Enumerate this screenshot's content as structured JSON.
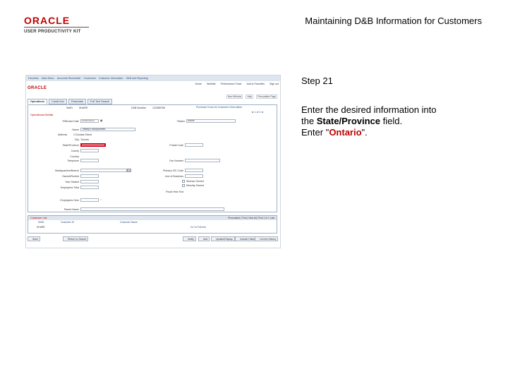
{
  "logo": {
    "word": "ORACLE",
    "sub": "USER PRODUCTIVITY KIT"
  },
  "page_title": "Maintaining D&B Information for Customers",
  "step_label": "Step 21",
  "instruction": {
    "line1": "Enter the desired information into",
    "line2_prefix": "the ",
    "field_name": "State/Province",
    "line2_suffix": " field.",
    "line3_prefix": "Enter \"",
    "value": "Ontario",
    "line3_suffix": "\"."
  },
  "screenshot": {
    "breadcrumbs": [
      "Favorites",
      "Main Menu",
      "Accounts Receivable",
      "Customers",
      "Customer Information",
      "D&B and Reporting"
    ],
    "oracle": "ORACLE",
    "nav_links": [
      "Home",
      "Worklist",
      "Performance Trace",
      "Add to Favorites",
      "Sign out"
    ],
    "page_links": [
      "New Window",
      "Help",
      "Personalize Page"
    ],
    "tabs": [
      {
        "label": "Operations",
        "active": true
      },
      {
        "label": "Credit Info",
        "active": false
      },
      {
        "label": "Financials",
        "active": false
      },
      {
        "label": "Full Text Search",
        "active": false
      }
    ],
    "header": {
      "setid_label": "SetID",
      "setid_value": "SHARE",
      "dnb_label": "D&B Number",
      "dnb_value": "123456789",
      "purchase_label": "Purchase Duns for Customer Information"
    },
    "panel_title": "Operational Details",
    "effective_date_label": "*Effective Date",
    "effective_date_value": "01/01/2013",
    "status_label": "*Status",
    "status_value": "Active",
    "name_label": "Name",
    "name_value": "Tiffany's Incorporated",
    "address_label": "Address",
    "address_value": "1 Dundas Street",
    "city_label": "City",
    "city_value": "Toronto",
    "state_label": "State/Province",
    "state_value": "",
    "postal_label": "Postal Code",
    "county_label": "County",
    "country_label": "Country",
    "telephone_label": "Telephone",
    "fax_label": "Fax Number",
    "headquarters_label": "Headquarters/Branch",
    "primary_sic_label": "Primary SIC Code",
    "owned_label": "Owned/Rented",
    "line_business_label": "Line of Business",
    "year_started_label": "Year Started",
    "woman_label": "Woman Owned",
    "minority_label": "Minority Owned",
    "fiscal_label": "Fiscal Year End",
    "employees_label": "Employees Total",
    "here_label": "Employees Here",
    "parent_label": "Parent Name",
    "grid": {
      "title": "Customer List",
      "controls": "Personalize | Find | View All | First 1 of 1 Last",
      "cols": [
        "SetID",
        "Customer ID",
        "Customer Name"
      ],
      "row": {
        "setid": "SHARE",
        "link": "Go To Full Info"
      }
    },
    "bottom_buttons": [
      "Save",
      "Return to Search",
      "Notify",
      "Add",
      "Update/Display",
      "Include History",
      "Correct History"
    ]
  }
}
